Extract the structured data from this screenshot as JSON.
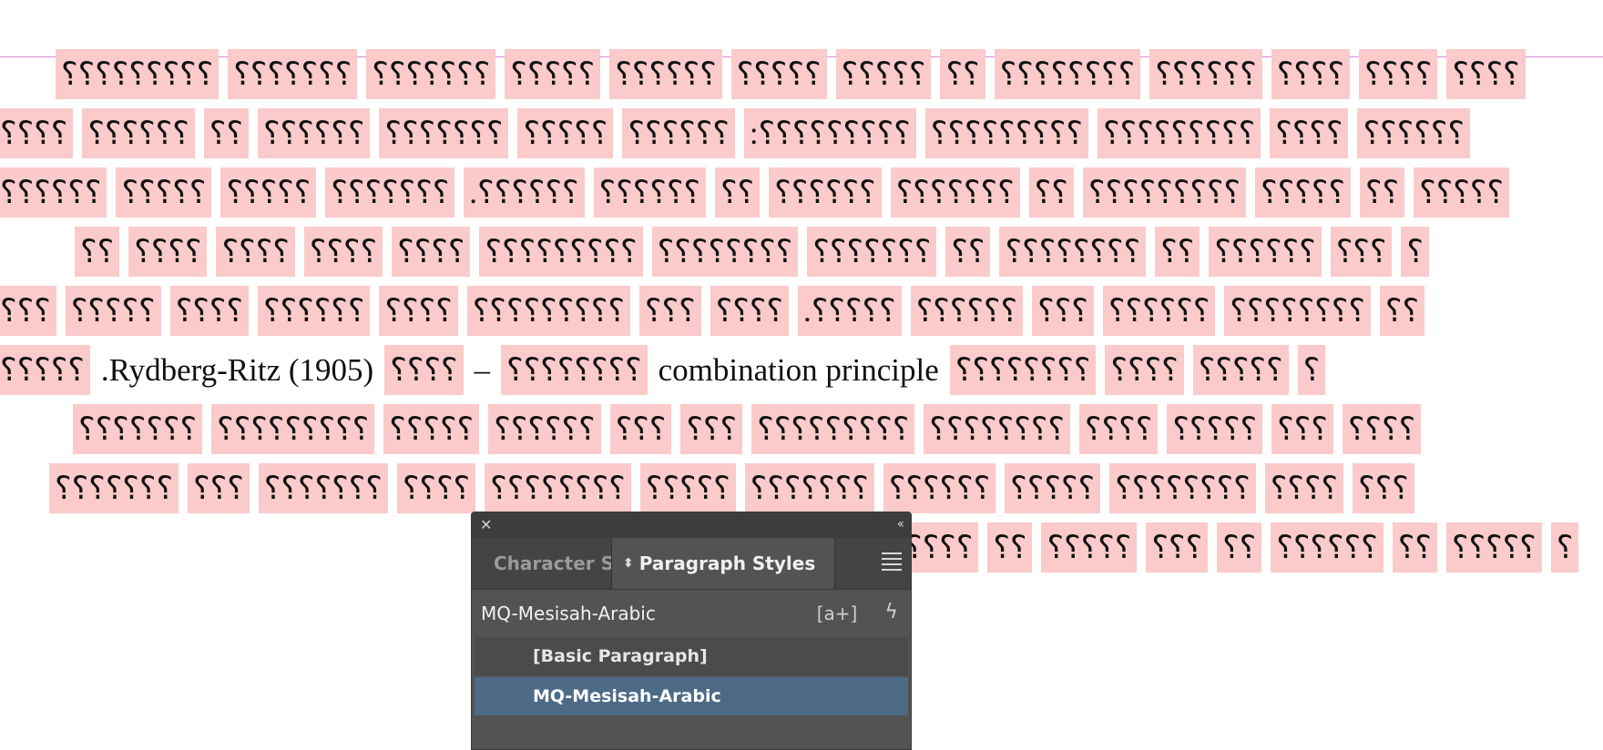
{
  "document": {
    "lines": [
      [
        "؟؟؟؟؟؟؟؟؟",
        "؟؟؟؟؟؟؟",
        "؟؟؟؟؟؟؟",
        "؟؟؟؟؟",
        "؟؟؟؟؟؟",
        "؟؟؟؟؟",
        "؟؟؟؟؟",
        "؟؟",
        "؟؟؟؟؟؟؟؟",
        "؟؟؟؟؟؟",
        "؟؟؟؟",
        "؟؟؟؟",
        "؟؟؟؟"
      ],
      [
        "؟؟؟؟",
        "؟؟؟؟؟؟",
        "؟؟",
        "؟؟؟؟؟؟",
        "؟؟؟؟؟؟؟",
        "؟؟؟؟؟",
        "؟؟؟؟؟؟",
        ":؟؟؟؟؟؟؟؟؟",
        "؟؟؟؟؟؟؟؟؟",
        "؟؟؟؟؟؟؟؟؟",
        "؟؟؟؟",
        "؟؟؟؟؟؟"
      ],
      [
        "؟؟؟؟؟؟",
        "؟؟؟؟؟",
        "؟؟؟؟؟",
        "؟؟؟؟؟؟؟",
        ".؟؟؟؟؟؟",
        "؟؟؟؟؟؟",
        "؟؟",
        "؟؟؟؟؟؟",
        "؟؟؟؟؟؟؟",
        "؟؟",
        "؟؟؟؟؟؟؟؟؟",
        "؟؟؟؟؟",
        "؟؟",
        "؟؟؟؟؟"
      ],
      [
        "؟؟",
        "؟؟؟؟",
        "؟؟؟؟",
        "؟؟؟؟",
        "؟؟؟؟",
        "؟؟؟؟؟؟؟؟؟",
        "؟؟؟؟؟؟؟؟",
        "؟؟؟؟؟؟؟",
        "؟؟",
        "؟؟؟؟؟؟؟؟",
        "؟؟",
        "؟؟؟؟؟؟",
        "؟؟؟",
        "؟"
      ],
      [
        "؟؟؟",
        "؟؟؟؟؟",
        "؟؟؟؟",
        "؟؟؟؟؟؟",
        "؟؟؟؟",
        "؟؟؟؟؟؟؟؟؟",
        "؟؟؟",
        "؟؟؟؟",
        ".؟؟؟؟؟",
        "؟؟؟؟؟؟",
        "؟؟؟",
        "؟؟؟؟؟؟",
        "؟؟؟؟؟؟؟؟",
        "؟؟"
      ],
      [
        "؟؟؟؟؟",
        ".Rydberg-Ritz (1905)",
        "؟؟؟؟",
        "–",
        "؟؟؟؟؟؟؟؟",
        "combination principle",
        "؟؟؟؟؟؟؟؟",
        "؟؟؟؟",
        "؟؟؟؟؟",
        "؟"
      ],
      [
        "؟؟؟؟؟؟؟",
        "؟؟؟؟؟؟؟؟؟",
        "؟؟؟؟؟",
        "؟؟؟؟؟؟",
        "؟؟؟",
        "؟؟؟",
        "؟؟؟؟؟؟؟؟؟",
        "؟؟؟؟؟؟؟؟",
        "؟؟؟؟",
        "؟؟؟؟؟",
        "؟؟؟",
        "؟؟؟؟"
      ],
      [
        "؟؟؟؟؟؟؟",
        "؟؟؟",
        "؟؟؟؟؟؟؟",
        "؟؟؟؟",
        "؟؟؟؟؟؟؟؟",
        "؟؟؟؟؟",
        "؟؟؟؟؟؟؟",
        "؟؟؟؟؟؟",
        "؟؟؟؟؟",
        "؟؟؟؟؟؟؟؟",
        "؟؟؟؟",
        "؟؟؟"
      ],
      [
        "؟؟؟؟",
        "؟؟",
        "؟؟؟؟؟",
        "؟؟؟",
        "؟؟",
        "؟؟؟؟؟؟",
        "؟؟",
        "؟؟؟؟؟",
        "؟"
      ]
    ]
  },
  "panel": {
    "tab_character": "Character S",
    "tab_paragraph": "Paragraph Styles",
    "current_style": "MQ-Mesisah-Arabic",
    "clear_overrides": "[a+]",
    "styles": [
      "[Basic Paragraph]",
      "MQ-Mesisah-Arabic"
    ],
    "selected_index": 1,
    "icons": {
      "close": "close-icon",
      "collapse": "collapse-icon",
      "updown": "updown-arrows-icon",
      "menu": "panel-menu-icon",
      "clear": "clear-overrides-icon",
      "flash": "lightning-icon"
    }
  }
}
